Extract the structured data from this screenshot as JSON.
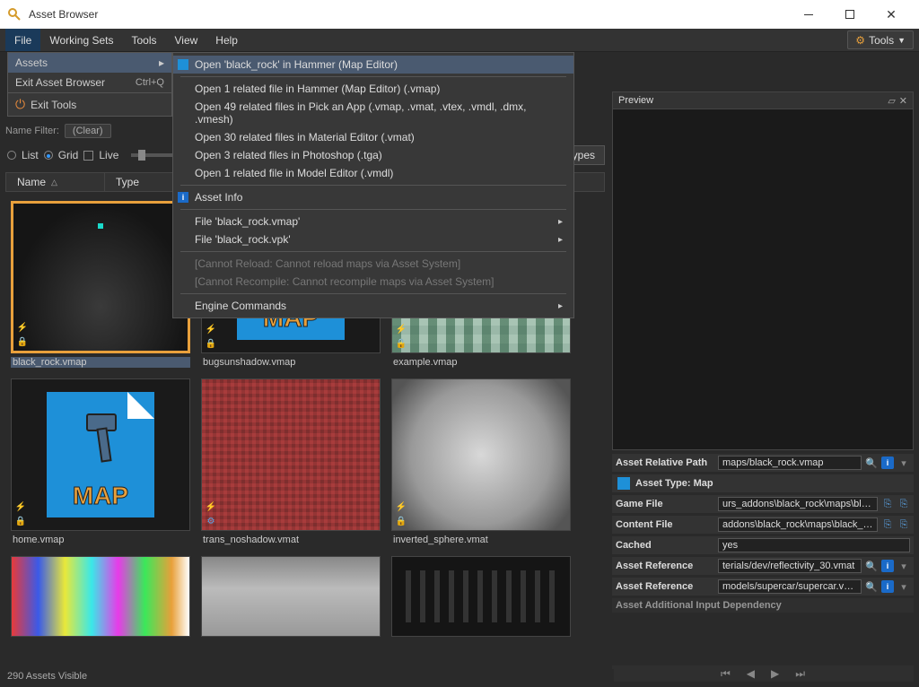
{
  "title": "Asset Browser",
  "menubar": [
    "File",
    "Working Sets",
    "Tools",
    "View",
    "Help"
  ],
  "tools_dropdown": "Tools",
  "file_menu": {
    "assets": "Assets",
    "exit_browser": "Exit Asset Browser",
    "exit_browser_shortcut": "Ctrl+Q",
    "exit_tools": "Exit Tools"
  },
  "submenu": {
    "open_hammer": "Open 'black_rock' in Hammer (Map Editor)",
    "open_1_hammer": "Open 1 related file in Hammer (Map Editor) (.vmap)",
    "open_49": "Open 49 related files in Pick an App (.vmap, .vmat, .vtex, .vmdl, .dmx, .vmesh)",
    "open_30": "Open 30 related files in Material Editor (.vmat)",
    "open_3": "Open 3 related files in Photoshop (.tga)",
    "open_1_model": "Open 1 related file in Model Editor (.vmdl)",
    "asset_info": "Asset Info",
    "file_vmap": "File 'black_rock.vmap'",
    "file_vpk": "File 'black_rock.vpk'",
    "cannot_reload": "[Cannot Reload: Cannot reload maps via Asset System]",
    "cannot_recompile": "[Cannot Recompile: Cannot recompile maps via Asset System]",
    "engine_commands": "Engine Commands"
  },
  "filters": {
    "name_filter_label": "Name Filter:",
    "clear": "(Clear)",
    "list": "List",
    "grid": "Grid",
    "live": "Live",
    "types_btn": "Types"
  },
  "columns": {
    "name": "Name",
    "type": "Type"
  },
  "assets": [
    {
      "label": "black_rock.vmap"
    },
    {
      "label": "bugsunshadow.vmap"
    },
    {
      "label": "example.vmap"
    },
    {
      "label": "home.vmap"
    },
    {
      "label": "trans_noshadow.vmat"
    },
    {
      "label": "inverted_sphere.vmat"
    }
  ],
  "preview": {
    "title": "Preview",
    "asset_relative_path_label": "Asset Relative Path",
    "asset_relative_path": "maps/black_rock.vmap",
    "asset_type_label": "Asset Type: Map",
    "game_file_label": "Game File",
    "game_file": "urs_addons\\black_rock\\maps\\black_rock.vpk",
    "content_file_label": "Content File",
    "content_file": "addons\\black_rock\\maps\\black_rock.vmap",
    "cached_label": "Cached",
    "cached": "yes",
    "asset_ref1_label": "Asset Reference",
    "asset_ref1": "terials/dev/reflectivity_30.vmat",
    "asset_ref2_label": "Asset Reference",
    "asset_ref2": "models/supercar/supercar.vmdl",
    "asset_add_label": "Asset Additional Input Dependency"
  },
  "status": "290 Assets Visible"
}
